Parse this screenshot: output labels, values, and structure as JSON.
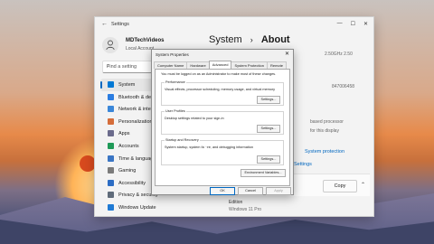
{
  "settings_window": {
    "app_title": "Settings",
    "user": {
      "name": "MDTechVideos",
      "account_type": "Local Account"
    },
    "search_placeholder": "Find a setting",
    "nav": [
      {
        "label": "System",
        "color": "#0078d4",
        "active": true
      },
      {
        "label": "Bluetooth & devices",
        "color": "#2b7de1"
      },
      {
        "label": "Network & internet",
        "color": "#3a87d9"
      },
      {
        "label": "Personalization",
        "color": "#d56d3a"
      },
      {
        "label": "Apps",
        "color": "#6b6b8c"
      },
      {
        "label": "Accounts",
        "color": "#1f9a58"
      },
      {
        "label": "Time & language",
        "color": "#3a75c4"
      },
      {
        "label": "Gaming",
        "color": "#7b7b7b"
      },
      {
        "label": "Accessibility",
        "color": "#2b6cc4"
      },
      {
        "label": "Privacy & security",
        "color": "#5f6b7a"
      },
      {
        "label": "Windows Update",
        "color": "#1f7ad4"
      }
    ],
    "breadcrumb": {
      "parent": "System",
      "current": "About"
    },
    "right_fragments": {
      "spec_speed": "2.50GHz   2.50",
      "device_id": "847006458",
      "processor": "based processor",
      "display": "for this display",
      "link_protection": "System protection",
      "link_settings": "Settings",
      "copy_button": "Copy",
      "edition_label": "Edition",
      "edition_value": "Windows 11 Pro"
    }
  },
  "dialog": {
    "title": "System Properties",
    "tabs": [
      "Computer Name",
      "Hardware",
      "Advanced",
      "System Protection",
      "Remote"
    ],
    "selected_tab": "Advanced",
    "admin_note": "You must be logged on as an Administrator to make most of these changes.",
    "performance": {
      "label": "Performance",
      "desc": "Visual effects, processor scheduling, memory usage, and virtual memory",
      "button": "Settings..."
    },
    "user_profiles": {
      "label": "User Profiles",
      "desc": "Desktop settings related to your sign-in",
      "button": "Settings..."
    },
    "startup": {
      "label": "Startup and Recovery",
      "desc": "System startup, system failure, and debugging information",
      "button": "Settings..."
    },
    "env_button": "Environment Variables...",
    "ok": "OK",
    "cancel": "Cancel",
    "apply": "Apply"
  }
}
